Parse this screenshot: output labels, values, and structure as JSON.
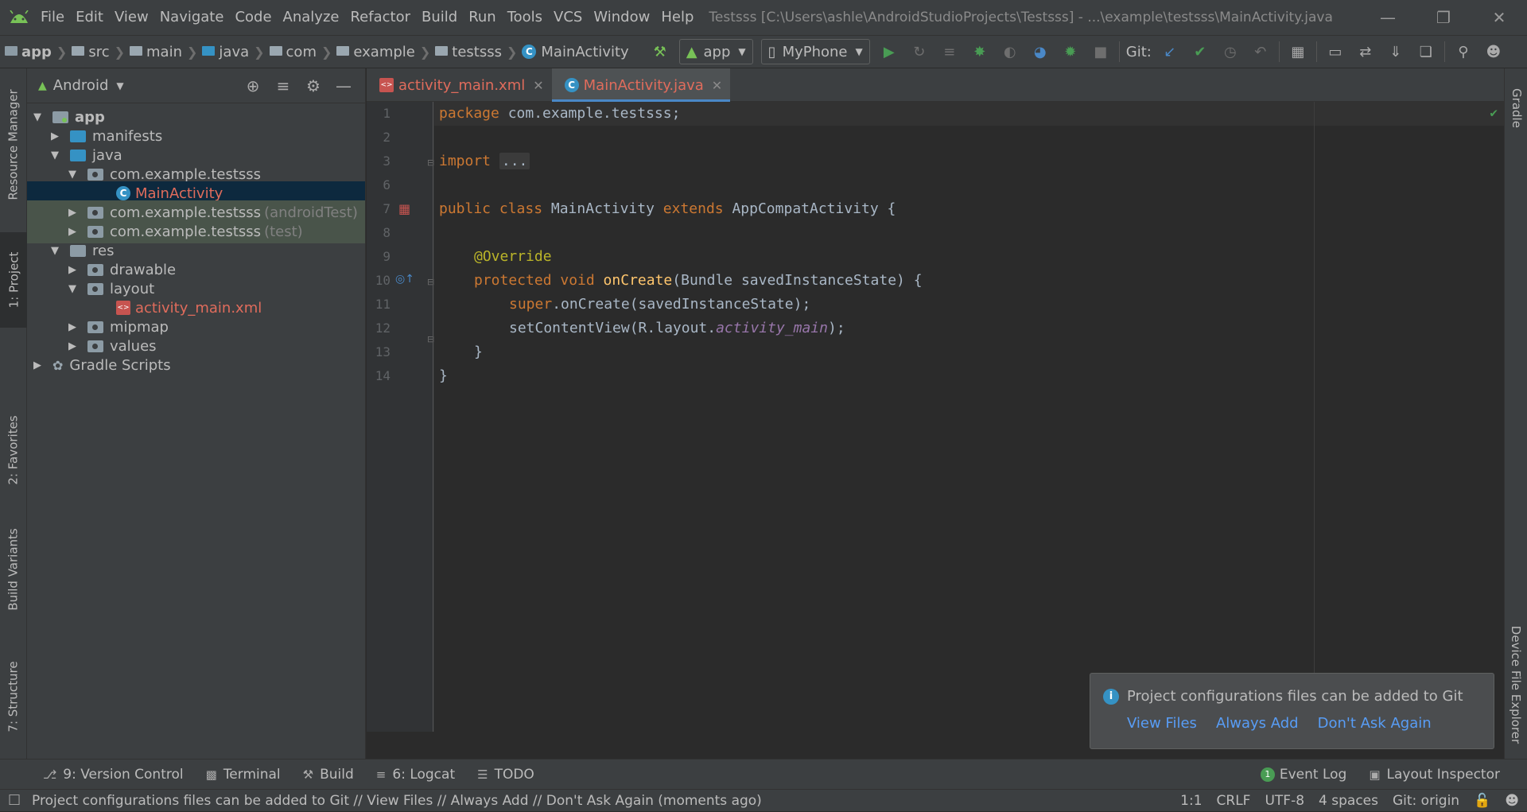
{
  "menu": [
    "File",
    "Edit",
    "View",
    "Navigate",
    "Code",
    "Analyze",
    "Refactor",
    "Build",
    "Run",
    "Tools",
    "VCS",
    "Window",
    "Help"
  ],
  "window_title": "Testsss [C:\\Users\\ashle\\AndroidStudioProjects\\Testsss] - ...\\example\\testsss\\MainActivity.java",
  "breadcrumbs": [
    "app",
    "src",
    "main",
    "java",
    "com",
    "example",
    "testsss",
    "MainActivity"
  ],
  "toolbar": {
    "run_config": "app",
    "device": "MyPhone",
    "git_label": "Git:"
  },
  "project_panel": {
    "title": "Android",
    "tree": [
      {
        "label": "app",
        "hint": ""
      },
      {
        "label": "manifests",
        "hint": ""
      },
      {
        "label": "java",
        "hint": ""
      },
      {
        "label": "com.example.testsss",
        "hint": ""
      },
      {
        "label": "MainActivity",
        "hint": ""
      },
      {
        "label": "com.example.testsss",
        "hint": "(androidTest)"
      },
      {
        "label": "com.example.testsss",
        "hint": "(test)"
      },
      {
        "label": "res",
        "hint": ""
      },
      {
        "label": "drawable",
        "hint": ""
      },
      {
        "label": "layout",
        "hint": ""
      },
      {
        "label": "activity_main.xml",
        "hint": ""
      },
      {
        "label": "mipmap",
        "hint": ""
      },
      {
        "label": "values",
        "hint": ""
      },
      {
        "label": "Gradle Scripts",
        "hint": ""
      }
    ]
  },
  "left_tool_tabs": [
    "Resource Manager",
    "1: Project",
    "2: Favorites",
    "Build Variants",
    "7: Structure"
  ],
  "right_tool_tabs": [
    "Gradle",
    "Device File Explorer"
  ],
  "editor_tabs": [
    {
      "label": "activity_main.xml",
      "active": false
    },
    {
      "label": "MainActivity.java",
      "active": true
    }
  ],
  "line_numbers": [
    "1",
    "2",
    "3",
    "6",
    "7",
    "8",
    "9",
    "10",
    "11",
    "12",
    "13",
    "14"
  ],
  "code": {
    "l1_kw": "package",
    "l1_rest": " com.example.testsss;",
    "l3_kw": "import",
    "l3_fold": "...",
    "l7_kw": "public class",
    "l7_name": " MainActivity ",
    "l7_ext": "extends",
    "l7_rest": " AppCompatActivity {",
    "l9_ann": "@Override",
    "l10_kw": "protected void",
    "l10_fn": " onCreate",
    "l10_rest": "(Bundle savedInstanceState) {",
    "l11_kw": "super",
    "l11_rest": ".onCreate(savedInstanceState);",
    "l12_a": "setContentView(R.layout.",
    "l12_it": "activity_main",
    "l12_b": ");",
    "l13": "}",
    "l14": "}"
  },
  "notification": {
    "message": "Project configurations files can be added to Git",
    "links": [
      "View Files",
      "Always Add",
      "Don't Ask Again"
    ]
  },
  "bottom_tools": [
    "9: Version Control",
    "Terminal",
    "Build",
    "6: Logcat",
    "TODO"
  ],
  "bottom_right_tools": {
    "event_log": "Event Log",
    "event_count": "1",
    "layout_inspector": "Layout Inspector"
  },
  "status": {
    "message": "Project configurations files can be added to Git // View Files // Always Add // Don't Ask Again (moments ago)",
    "position": "1:1",
    "line_sep": "CRLF",
    "encoding": "UTF-8",
    "indent": "4 spaces",
    "git": "Git: origin"
  },
  "colors": {
    "accent": "#4a88c7",
    "run_green": "#499c54",
    "link": "#589df6",
    "modified_red": "#c75450"
  }
}
